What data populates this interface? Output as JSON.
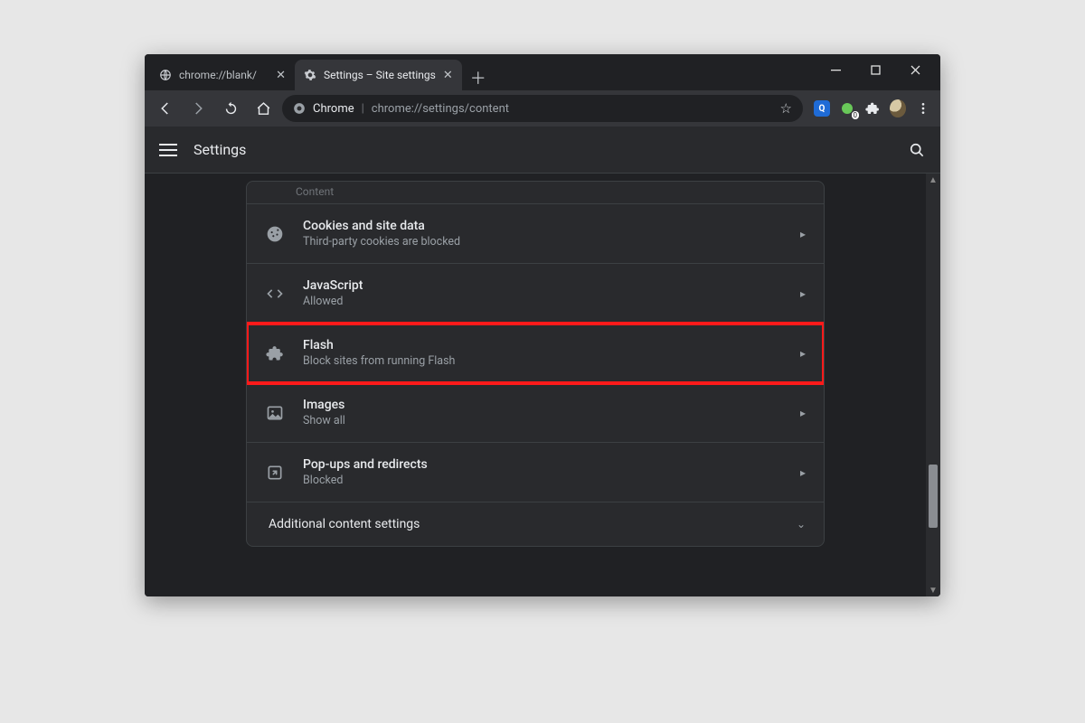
{
  "window": {
    "tabs": [
      {
        "title": "chrome://blank/",
        "active": false
      },
      {
        "title": "Settings – Site settings",
        "active": true
      }
    ]
  },
  "toolbar": {
    "site_label": "Chrome",
    "url_path": "chrome://settings/content"
  },
  "appbar": {
    "title": "Settings"
  },
  "panel": {
    "section_label": "Content",
    "rows": [
      {
        "icon": "cookie",
        "title": "Cookies and site data",
        "subtitle": "Third-party cookies are blocked"
      },
      {
        "icon": "code",
        "title": "JavaScript",
        "subtitle": "Allowed"
      },
      {
        "icon": "puzzle",
        "title": "Flash",
        "subtitle": "Block sites from running Flash",
        "highlight": true
      },
      {
        "icon": "image",
        "title": "Images",
        "subtitle": "Show all"
      },
      {
        "icon": "popup",
        "title": "Pop-ups and redirects",
        "subtitle": "Blocked"
      }
    ],
    "additional_label": "Additional content settings"
  }
}
